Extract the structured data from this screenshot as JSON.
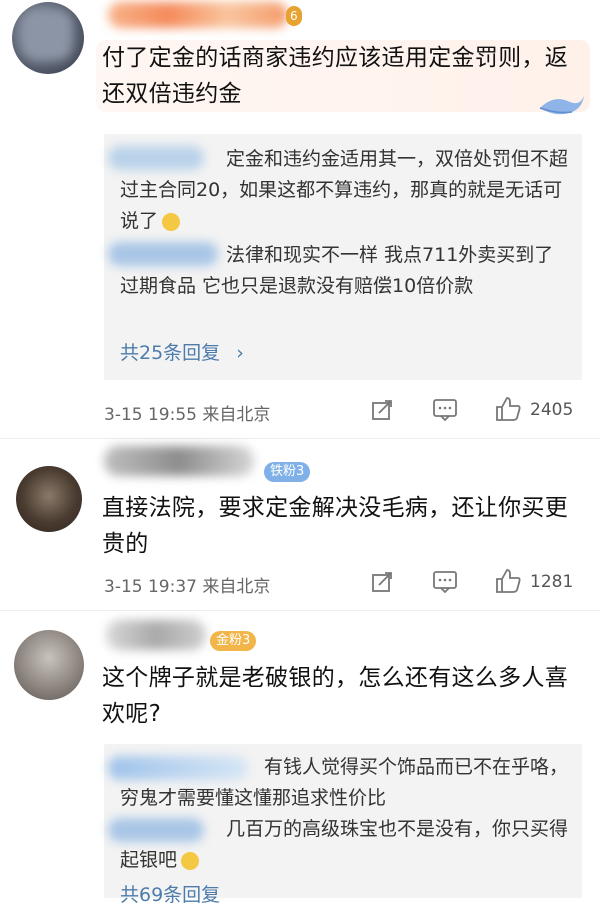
{
  "comments": [
    {
      "badge": "6",
      "content": "付了定金的话商家违约应该适用定金罚则，返还双倍违约金",
      "replies": [
        "定金和违约金适用其一，双倍处罚但不超过主合同20，如果这都不算违约，那真的就是无话可说了",
        "法律和现实不一样 我点711外卖买到了过期食品 它也只是退款没有赔偿10倍价款"
      ],
      "more_replies": "共25条回复",
      "time": "3-15 19:55 来自北京",
      "likes": "2405"
    },
    {
      "badge": "铁粉3",
      "content": "直接法院，要求定金解决没毛病，还让你买更贵的",
      "time": "3-15 19:37 来自北京",
      "likes": "1281"
    },
    {
      "badge": "金粉3",
      "content": "这个牌子就是老破银的，怎么还有这么多人喜欢呢?",
      "replies": [
        "有钱人觉得买个饰品而已不在乎咯，穷鬼才需要懂这懂那追求性价比",
        "几百万的高级珠宝也不是没有，你只买得起银吧"
      ],
      "more_replies": "共69条回复"
    }
  ],
  "colors": {
    "link": "#4d7cab",
    "reply_bg": "#f3f3f3",
    "badge_fan": "#7fb1e8",
    "badge_gold": "#f2b54a"
  },
  "icons": [
    "share-icon",
    "comment-icon",
    "like-icon",
    "arrow-right-icon"
  ]
}
